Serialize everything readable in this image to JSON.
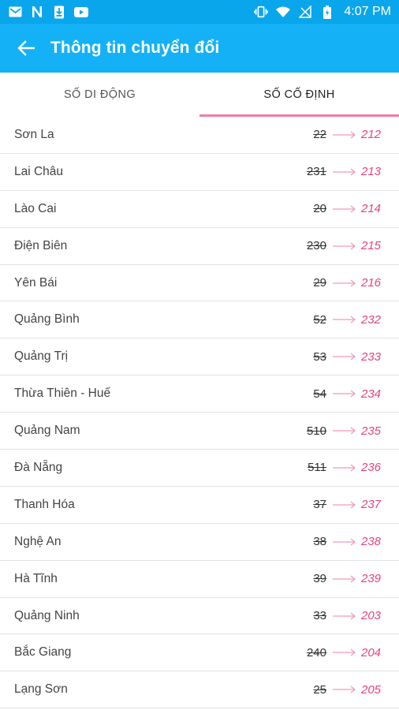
{
  "status_bar": {
    "time": "4:07 PM",
    "left_icons": [
      "gmail-icon",
      "n-app-icon",
      "sim-download-icon",
      "youtube-icon"
    ],
    "right_icons": [
      "vibrate-icon",
      "wifi-icon",
      "no-signal-icon",
      "battery-icon"
    ]
  },
  "app_bar": {
    "title": "Thông tin chuyển đổi",
    "back_icon": "arrow-left-icon",
    "color": "#14b1f7"
  },
  "tabs": [
    {
      "label": "SỐ DI ĐỘNG",
      "active": false
    },
    {
      "label": "SỐ CỐ ĐỊNH",
      "active": true
    }
  ],
  "accent_color": "#ef7ea2",
  "new_code_color": "#e7437b",
  "rows": [
    {
      "province": "Sơn La",
      "old": "22",
      "new": "212"
    },
    {
      "province": "Lai Châu",
      "old": "231",
      "new": "213"
    },
    {
      "province": "Lào Cai",
      "old": "20",
      "new": "214"
    },
    {
      "province": "Điện Biên",
      "old": "230",
      "new": "215"
    },
    {
      "province": "Yên Bái",
      "old": "29",
      "new": "216"
    },
    {
      "province": "Quảng Bình",
      "old": "52",
      "new": "232"
    },
    {
      "province": "Quảng Trị",
      "old": "53",
      "new": "233"
    },
    {
      "province": "Thừa Thiên - Huế",
      "old": "54",
      "new": "234"
    },
    {
      "province": "Quảng Nam",
      "old": "510",
      "new": "235"
    },
    {
      "province": "Đà Nẵng",
      "old": "511",
      "new": "236"
    },
    {
      "province": "Thanh Hóa",
      "old": "37",
      "new": "237"
    },
    {
      "province": "Nghệ An",
      "old": "38",
      "new": "238"
    },
    {
      "province": "Hà Tĩnh",
      "old": "39",
      "new": "239"
    },
    {
      "province": "Quảng Ninh",
      "old": "33",
      "new": "203"
    },
    {
      "province": "Bắc Giang",
      "old": "240",
      "new": "204"
    },
    {
      "province": "Lạng Sơn",
      "old": "25",
      "new": "205"
    }
  ]
}
